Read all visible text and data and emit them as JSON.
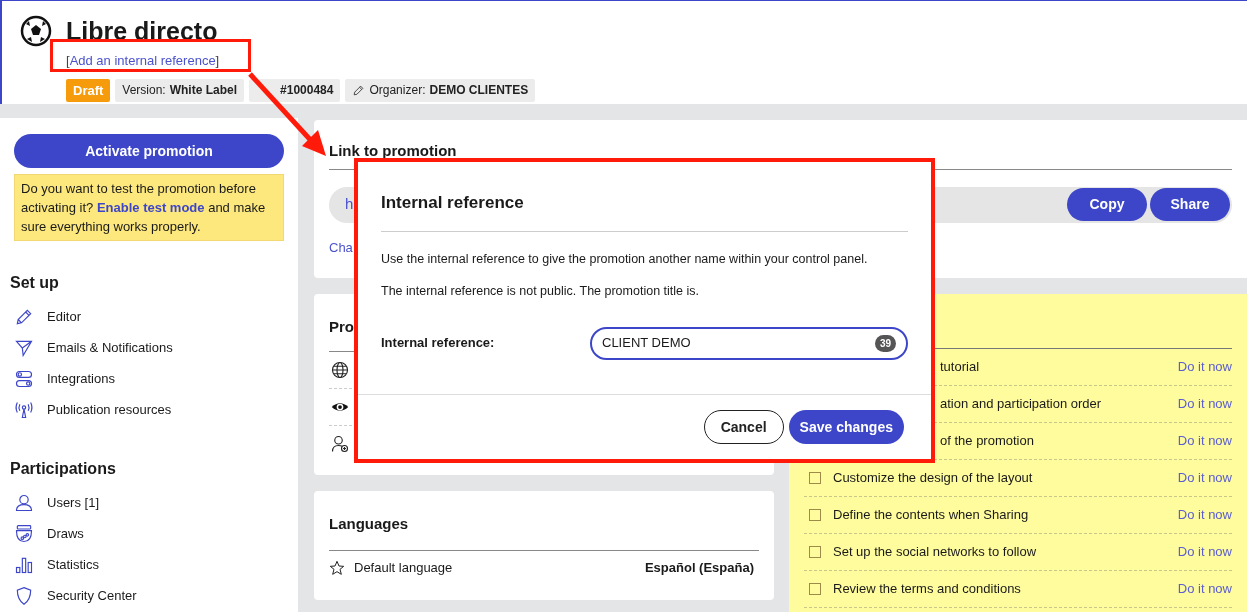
{
  "header": {
    "title": "Libre directo",
    "reference_link": {
      "open": "[",
      "label": "Add an internal reference",
      "close": "]"
    },
    "tags": [
      {
        "kind": "status",
        "value": "Draft"
      },
      {
        "kind": "info",
        "label": "Version:",
        "value": "White Label"
      },
      {
        "kind": "info",
        "value": "#1000484"
      },
      {
        "kind": "organizer",
        "label": "Organizer:",
        "value": "DEMO CLIENTES"
      }
    ]
  },
  "sidebar": {
    "primary_button": "Activate promotion",
    "notice": {
      "before": "Do you want to test the promotion before activating it?",
      "link": "Enable test mode",
      "after": "and make sure everything works properly."
    },
    "sections": [
      {
        "title": "Set up",
        "items": [
          "Editor",
          "Emails & Notifications",
          "Integrations",
          "Publication resources"
        ]
      },
      {
        "title": "Participations",
        "items": [
          "Users [1]",
          "Draws",
          "Statistics",
          "Security Center"
        ]
      }
    ]
  },
  "link_card": {
    "title": "Link to promotion",
    "url": "h",
    "buttons": [
      "Copy",
      "Share"
    ],
    "link": "Cha"
  },
  "promotion_card": {
    "title": "Pro"
  },
  "languages_card": {
    "title": "Languages",
    "rows": [
      {
        "label": "Default language",
        "value": "Español (España)"
      }
    ]
  },
  "checklist": {
    "items": [
      {
        "text": "tutorial",
        "covered": true,
        "action": "Do it now"
      },
      {
        "text": "ation and participation order",
        "covered": true,
        "action": "Do it now"
      },
      {
        "text": "of the promotion",
        "covered": true,
        "action": "Do it now"
      },
      {
        "text": "Customize the design of the layout",
        "checked": false,
        "action": "Do it now"
      },
      {
        "text": "Define the contents when Sharing",
        "checked": false,
        "action": "Do it now"
      },
      {
        "text": "Set up the social networks to follow",
        "checked": false,
        "action": "Do it now"
      },
      {
        "text": "Review the terms and conditions",
        "checked": false,
        "action": "Do it now"
      }
    ]
  },
  "dialog": {
    "title": "Internal reference",
    "paragraphs": [
      "Use the internal reference to give the promotion another name within your control panel.",
      "The internal reference is not public. The promotion title is."
    ],
    "field": {
      "label": "Internal reference:",
      "value": "CLIENT DEMO",
      "counter": "39"
    },
    "buttons": [
      {
        "kind": "secondary",
        "label": "Cancel"
      },
      {
        "kind": "primary",
        "label": "Save changes"
      }
    ]
  }
}
